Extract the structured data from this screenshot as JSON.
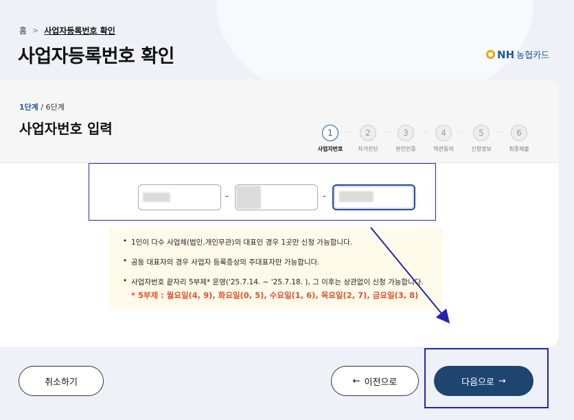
{
  "breadcrumb": {
    "home": "홈",
    "separator": ">",
    "current": "사업자등록번호 확인"
  },
  "page_title": "사업자등록번호 확인",
  "logo": {
    "brand": "NH",
    "sub": "농협카드"
  },
  "step": {
    "current_label": "1단계",
    "total_label": " / 6단계",
    "title": "사업자번호 입력"
  },
  "stepper": [
    {
      "num": "1",
      "label": "사업자번호",
      "active": true
    },
    {
      "num": "2",
      "label": "자가진단",
      "active": false
    },
    {
      "num": "3",
      "label": "본인인증",
      "active": false
    },
    {
      "num": "4",
      "label": "약관동의",
      "active": false
    },
    {
      "num": "5",
      "label": "신청정보",
      "active": false
    },
    {
      "num": "6",
      "label": "최종제출",
      "active": false
    }
  ],
  "stepper_dots": "···",
  "business_number": {
    "separator": "-"
  },
  "notice": {
    "items": [
      "1인이 다수 사업체(법인.개인무관)의 대표인 경우 1곳만 신청 가능합니다.",
      "공동 대표자의 경우 사업자 등록증상의 주대표자만 가능합니다.",
      "사업자번호 끝자리 5부제* 운영('25.7.14. ~ '25.7.18. ), 그 이후는 상관없이 신청 가능합니다."
    ],
    "highlight": "* 5부제 : 월요일(4, 9), 화요일(0, 5), 수요일(1, 6), 목요일(2, 7), 금요일(3, 8)"
  },
  "buttons": {
    "cancel": "취소하기",
    "prev": "이전으로",
    "next": "다음으로"
  },
  "colors": {
    "accent": "#1f5aa6",
    "next_button": "#1e4470",
    "highlight": "#e8502e",
    "annotation": "#2323b0"
  }
}
